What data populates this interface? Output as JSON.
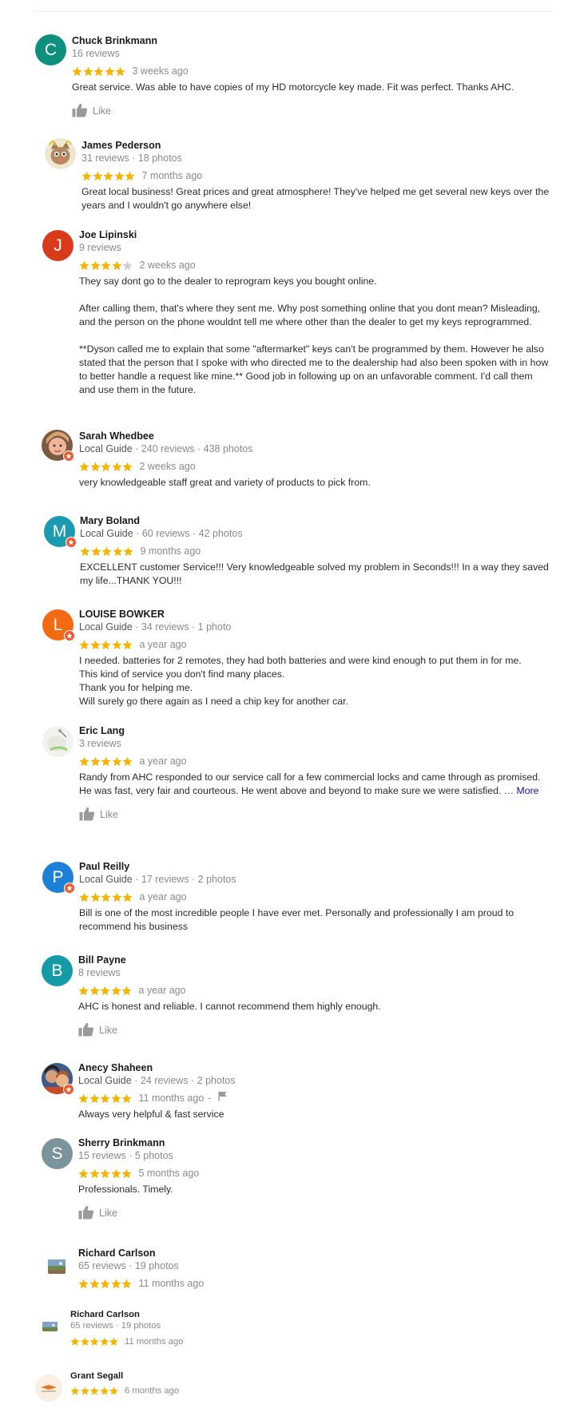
{
  "colors": {
    "star": "#f5b400",
    "star_empty": "#cfcfcf",
    "local_guide_badge": "#f1592a",
    "more_link": "#1a0dab"
  },
  "like_label": "Like",
  "more_label": "… More",
  "reviews": [
    {
      "name": "Chuck Brinkmann",
      "initial": "C",
      "avatar_color": "#0f8f7e",
      "local_guide": false,
      "meta": "16 reviews",
      "stars": 5,
      "ago": "3 weeks ago",
      "text": [
        "Great service. Was able to have copies of my HD motorcycle key made. Fit was perfect. Thanks AHC."
      ]
    },
    {
      "name": "James Pederson",
      "initial": "",
      "avatar_icon": "cartoon-cat-avatar",
      "local_guide": false,
      "meta": "31 reviews · 18 photos",
      "stars": 5,
      "ago": "7 months ago",
      "text": [
        "Great local business! Great prices and great atmosphere! They've helped me get several new keys over the years and I wouldn't go anywhere else!"
      ]
    },
    {
      "name": "Joe Lipinski",
      "initial": "J",
      "avatar_color": "#d93a1a",
      "local_guide": false,
      "meta": "9 reviews",
      "stars": 4,
      "ago": "2 weeks ago",
      "text": [
        "They say dont go to the dealer to reprogram keys you bought online.",
        "After calling them, that's where they sent me. Why post something online that you dont mean? Misleading, and the person on the phone wouldnt tell me where other than the dealer to get my keys reprogrammed.",
        "**Dyson called me to explain that some \"aftermarket\" keys can't be programmed by them. However he also stated that the person that I spoke with who directed me to the dealership had also been spoken with in how to better handle a request like mine.** Good job in following up on an unfavorable comment. I'd call them and use them in the future."
      ]
    },
    {
      "name": "Sarah Whedbee",
      "initial": "",
      "avatar_icon": "photo-avatar",
      "local_guide": true,
      "meta_guide": "Local Guide",
      "meta": " · 240 reviews · 438 photos",
      "stars": 5,
      "ago": "2 weeks ago",
      "text": [
        "very knowledgeable staff great and variety of products to pick from."
      ]
    },
    {
      "name": "Mary Boland",
      "initial": "M",
      "avatar_color": "#1a9bb0",
      "local_guide": true,
      "meta_guide": "Local Guide",
      "meta": " · 60 reviews · 42 photos",
      "stars": 5,
      "ago": "9 months ago",
      "text": [
        "EXCELLENT customer Service!!! Very knowledgeable solved my problem in Seconds!!! In a way they saved my life...THANK YOU!!!"
      ]
    },
    {
      "name": "LOUISE BOWKER",
      "initial": "L",
      "avatar_color": "#f36a12",
      "local_guide": true,
      "meta_guide": "Local Guide",
      "meta": " · 34 reviews · 1 photo",
      "stars": 5,
      "ago": "a year ago",
      "text": [
        "I needed. batteries for 2 remotes, they had both batteries and were kind enough to put them in for me.",
        "This kind of service you don't find many places.",
        "Thank you for helping me.",
        "Will surely go there again as I need a chip key for another car."
      ]
    },
    {
      "name": "Eric Lang",
      "initial": "",
      "avatar_icon": "photo-avatar",
      "local_guide": false,
      "meta": "3 reviews",
      "stars": 5,
      "ago": "a year ago",
      "text": [
        "Randy from AHC responded to our service call for a few commercial locks and came through as promised.  He was fast, very fair and courteous.  He went above and beyond to make sure we were satisfied. "
      ]
    },
    {
      "name": "Paul Reilly",
      "initial": "P",
      "avatar_color": "#1e7fd6",
      "local_guide": true,
      "meta_guide": "Local Guide",
      "meta": " · 17 reviews · 2 photos",
      "stars": 5,
      "ago": "a year ago",
      "text": [
        "Bill is one of the most incredible people I have ever met. Personally and professionally I am proud to recommend his business"
      ]
    },
    {
      "name": "Bill Payne",
      "initial": "B",
      "avatar_color": "#159aa8",
      "local_guide": false,
      "meta": "8 reviews",
      "stars": 5,
      "ago": "a year ago",
      "text": [
        "AHC is honest and reliable. I cannot recommend them highly enough."
      ]
    },
    {
      "name": "Anecy Shaheen",
      "initial": "",
      "avatar_icon": "photo-avatar",
      "local_guide": true,
      "meta_guide": "Local Guide",
      "meta": " · 24 reviews · 2 photos",
      "stars": 5,
      "ago": "11 months ago",
      "text": [
        "Always very helpful & fast service"
      ]
    },
    {
      "name": "Sherry Brinkmann",
      "initial": "S",
      "avatar_color": "#7a939c",
      "local_guide": false,
      "meta": "15 reviews · 5 photos",
      "stars": 5,
      "ago": "5 months ago",
      "text": [
        "Professionals. Timely."
      ]
    },
    {
      "name": "Richard Carlson",
      "initial": "",
      "avatar_icon": "landscape-photo-avatar",
      "local_guide": false,
      "meta": "65 reviews · 19 photos",
      "stars": 5,
      "ago": "11 months ago",
      "text": []
    },
    {
      "name": "Richard Carlson",
      "initial": "",
      "avatar_icon": "landscape-photo-avatar",
      "local_guide": false,
      "meta": "65 reviews · 19 photos",
      "stars": 5,
      "ago": "11 months ago",
      "text": []
    },
    {
      "name": "Grant Segall",
      "initial": "",
      "avatar_icon": "logo-avatar",
      "local_guide": false,
      "meta": "",
      "stars": 5,
      "ago": "6 months ago",
      "text": []
    }
  ]
}
